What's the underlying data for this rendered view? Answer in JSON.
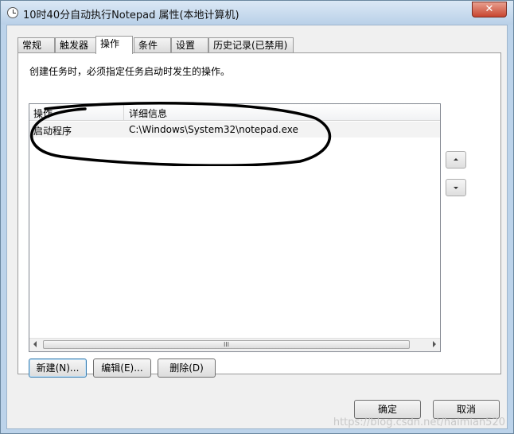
{
  "window": {
    "title": "10时40分自动执行Notepad 属性(本地计算机)",
    "close_glyph": "✕"
  },
  "tabs": [
    "常规",
    "触发器",
    "操作",
    "条件",
    "设置",
    "历史记录(已禁用)"
  ],
  "active_tab": "操作",
  "panel": {
    "description": "创建任务时，必须指定任务启动时发生的操作。",
    "columns": [
      "操作",
      "详细信息"
    ],
    "rows": [
      {
        "action": "启动程序",
        "details": "C:\\Windows\\System32\\notepad.exe"
      }
    ],
    "scroll_thumb_glyph": "III",
    "buttons": {
      "new": "新建(N)...",
      "edit": "编辑(E)...",
      "delete": "删除(D)"
    }
  },
  "footer": {
    "ok": "确定",
    "cancel": "取消"
  },
  "watermark": "https://blog.csdn.net/haimian520",
  "icons": [
    "clock-icon",
    "move-up-icon",
    "move-down-icon",
    "scroll-left-icon",
    "scroll-right-icon"
  ]
}
